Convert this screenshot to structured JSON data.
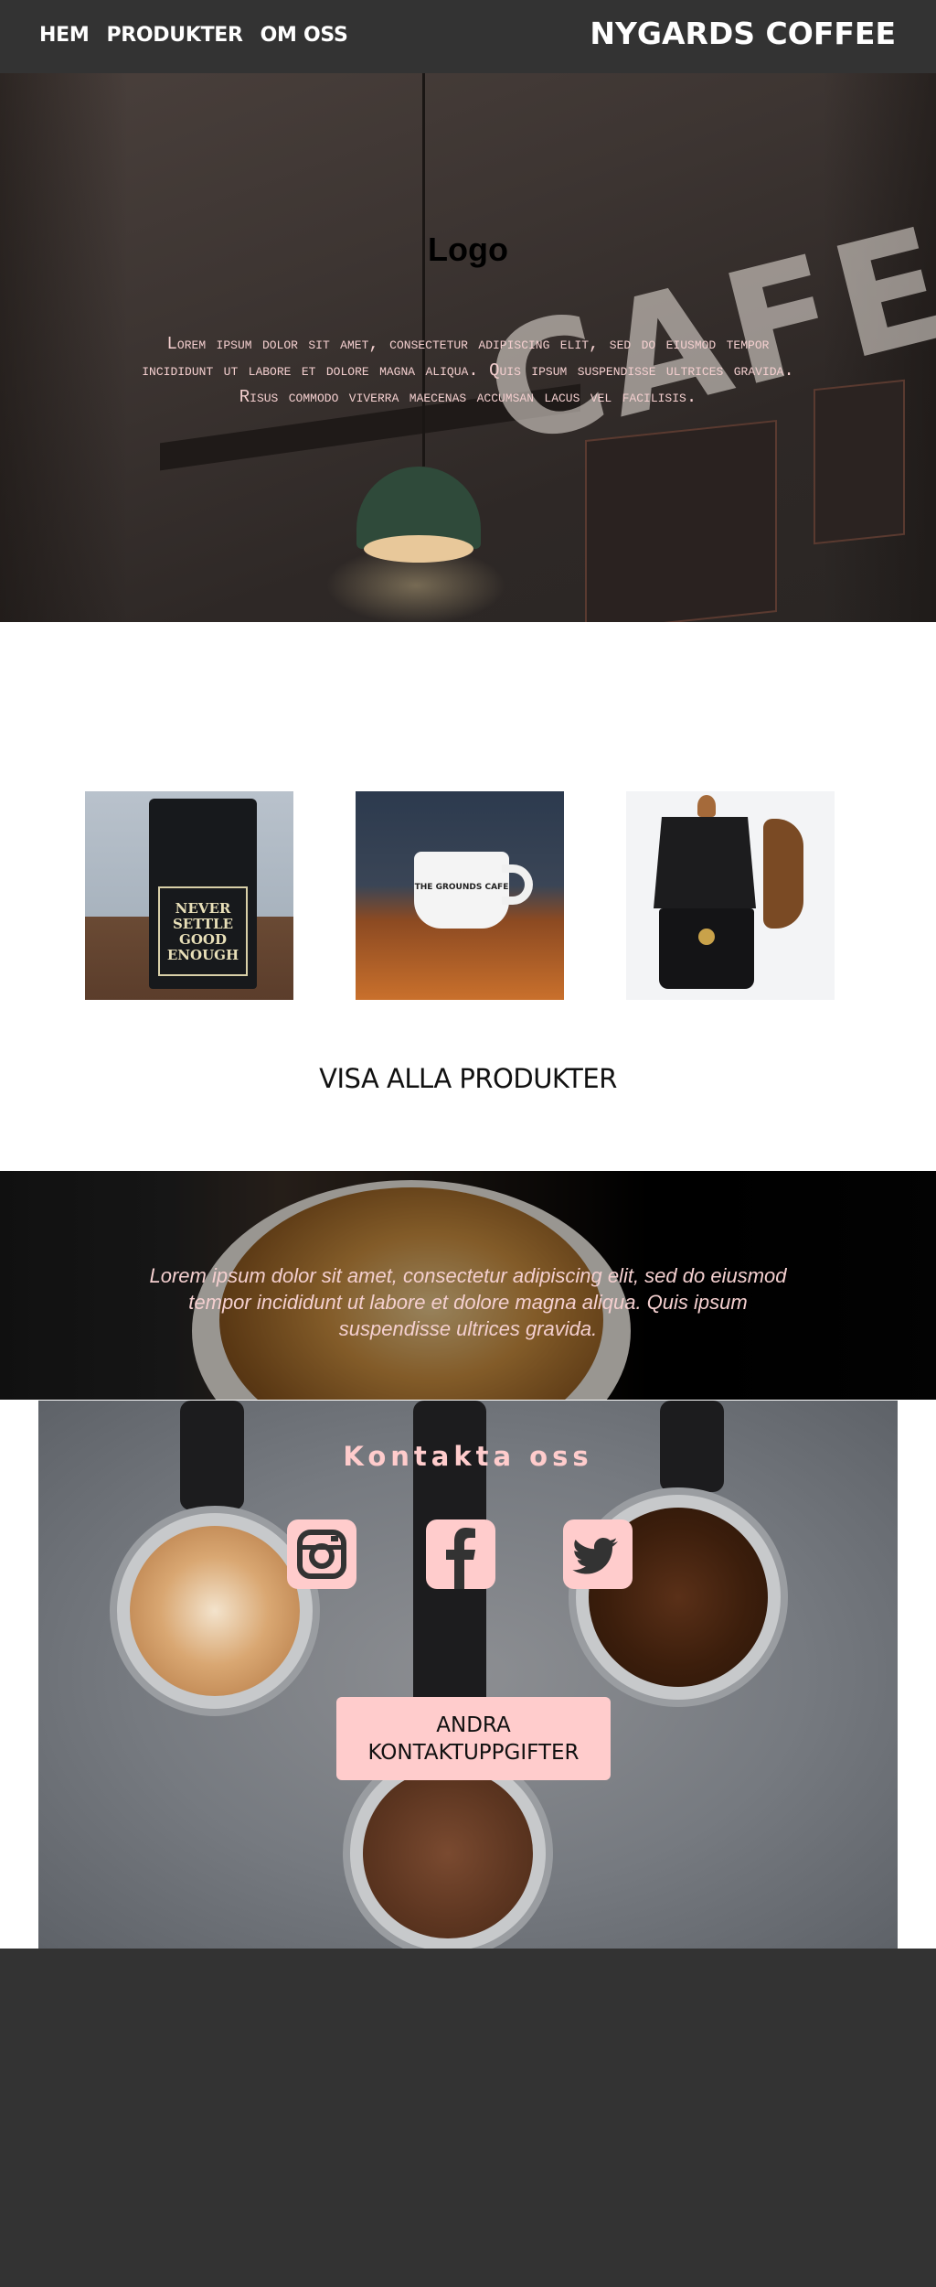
{
  "nav": {
    "links": [
      "HEM",
      "PRODUKTER",
      "OM OSS"
    ],
    "brand": "NYGARDS COFFEE"
  },
  "hero": {
    "title": "Logo",
    "text": "Lorem ipsum dolor sit amet, consectetur adipiscing elit, sed do eiusmod tempor incididunt ut labore et dolore magna aliqua. Quis ipsum suspendisse ultrices gravida. Risus commodo viverra maecenas accumsan lacus vel facilisis.",
    "sign_text": "CAFE"
  },
  "products": {
    "items": [
      {
        "label_text": "NEVER SETTLE GOOD ENOUGH"
      },
      {
        "label_text": "THE GROUNDS CAFE"
      },
      {
        "label_text": ""
      }
    ],
    "see_all": "VISA ALLA PRODUKTER"
  },
  "quote": {
    "text": "Lorem ipsum dolor sit amet, consectetur adipiscing elit, sed do eiusmod tempor incididunt ut labore et dolore magna aliqua. Quis ipsum suspendisse ultrices gravida."
  },
  "contact": {
    "title": "Kontakta oss",
    "socials": [
      "instagram-icon",
      "facebook-icon",
      "twitter-icon"
    ],
    "other_button": "ANDRA KONTAKTUPPGIFTER"
  },
  "colors": {
    "nav_bg": "#333333",
    "accent_pink": "#ffcccc",
    "footer_bg": "#333333"
  }
}
